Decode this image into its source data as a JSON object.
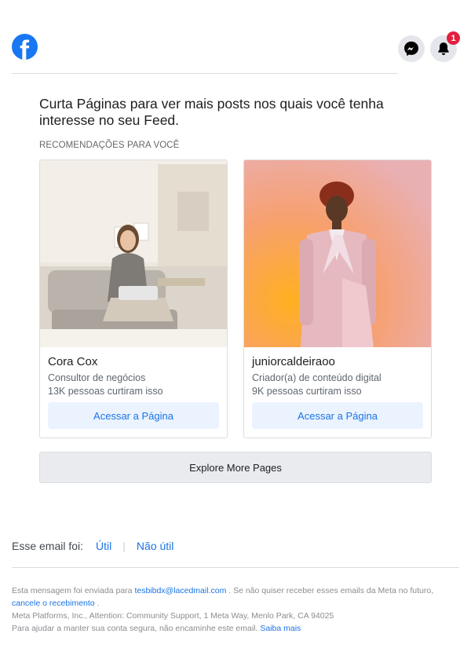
{
  "header": {
    "logo_letter": "f",
    "notification_count": "1"
  },
  "headline": "Curta Páginas para ver mais posts nos quais você tenha interesse no seu Feed.",
  "section_label": "RECOMENDAÇÕES PARA VOCÊ",
  "cards": [
    {
      "name": "Cora Cox",
      "category": "Consultor de negócios",
      "likes": "13K pessoas curtiram isso",
      "button": "Acessar a Página"
    },
    {
      "name": "juniorcaldeiraoo",
      "category": "Criador(a) de conteúdo digital",
      "likes": "9K pessoas curtiram isso",
      "button": "Acessar a Página"
    }
  ],
  "explore_button": "Explore More Pages",
  "feedback": {
    "prompt": "Esse email foi:",
    "useful": "Útil",
    "separator": "|",
    "not_useful": "Não útil"
  },
  "footer": {
    "line1_prefix": "Esta mensagem foi enviada para",
    "email": "tesbibdx@lacedmail.com",
    "line1_suffix": ". Se não quiser receber esses emails da Meta no futuro,",
    "unsubscribe": "cancele o recebimento",
    "unsubscribe_suffix": ".",
    "address": "Meta Platforms, Inc., Attention: Community Support, 1 Meta Way, Menlo Park, CA 94025",
    "security_text": "Para ajudar a manter sua conta segura, não encaminhe este email.",
    "learn_more": "Saiba mais"
  },
  "colors": {
    "brand": "#1877f2",
    "link": "#1b74e4",
    "badge": "#e41e3f"
  },
  "icons": [
    "facebook-logo",
    "messenger-icon",
    "bell-icon"
  ]
}
